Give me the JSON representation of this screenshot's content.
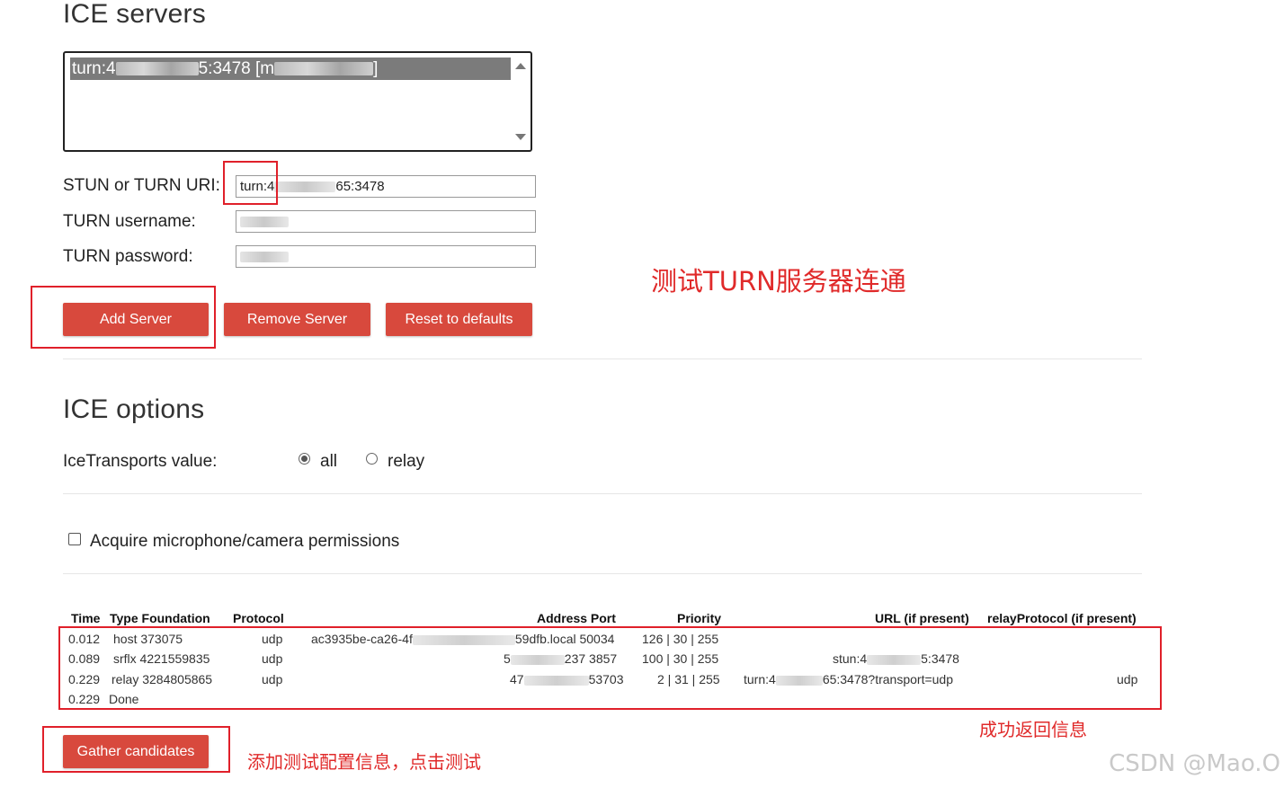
{
  "ice_servers": {
    "heading": "ICE servers",
    "list_item": {
      "prefix": "turn:4",
      "middle": "5:3478 [m",
      "suffix": "]"
    },
    "stun_label": "STUN or TURN URI:",
    "stun_value": {
      "prefix": "turn:4",
      "suffix": "65:3478"
    },
    "username_label": "TURN username:",
    "password_label": "TURN password:",
    "add_button": "Add Server",
    "remove_button": "Remove Server",
    "reset_button": "Reset to defaults"
  },
  "ice_options": {
    "heading": "ICE options",
    "transports_label": "IceTransports value:",
    "option_all": "all",
    "option_relay": "relay",
    "selected": "all",
    "acquire_label": "Acquire microphone/camera permissions",
    "acquire_checked": false
  },
  "candidates": {
    "headers": {
      "time": "Time",
      "type_foundation": "Type Foundation",
      "protocol": "Protocol",
      "address_port": "Address Port",
      "priority": "Priority",
      "url": "URL (if present)",
      "relay_protocol": "relayProtocol (if present)"
    },
    "rows": [
      {
        "time": "0.012",
        "type": "host 373075",
        "protocol": "udp",
        "addr_prefix": "ac3935be-ca26-4f",
        "addr_suffix": "59dfb.local 50034",
        "priority": "126 | 30 | 255",
        "url_prefix": "",
        "url_suffix": "",
        "relay": ""
      },
      {
        "time": "0.089",
        "type": "srflx 4221559835",
        "protocol": "udp",
        "addr_prefix": "5",
        "addr_suffix": "237 3857",
        "priority": "100 | 30 | 255",
        "url_prefix": "stun:4",
        "url_suffix": "5:3478",
        "relay": ""
      },
      {
        "time": "0.229",
        "type": "relay 3284805865",
        "protocol": "udp",
        "addr_prefix": "47",
        "addr_suffix": "53703",
        "priority": "2 | 31 | 255",
        "url_prefix": "turn:4",
        "url_suffix": "65:3478?transport=udp",
        "relay": "udp"
      }
    ],
    "done_time": "0.229",
    "done_label": "Done",
    "gather_button": "Gather candidates"
  },
  "annotations": {
    "test_turn": "测试TURN服务器连通",
    "success": "成功返回信息",
    "add_and_click": "添加测试配置信息，点击测试",
    "color": "#e02a2a"
  },
  "watermark": "CSDN @Mao.O"
}
